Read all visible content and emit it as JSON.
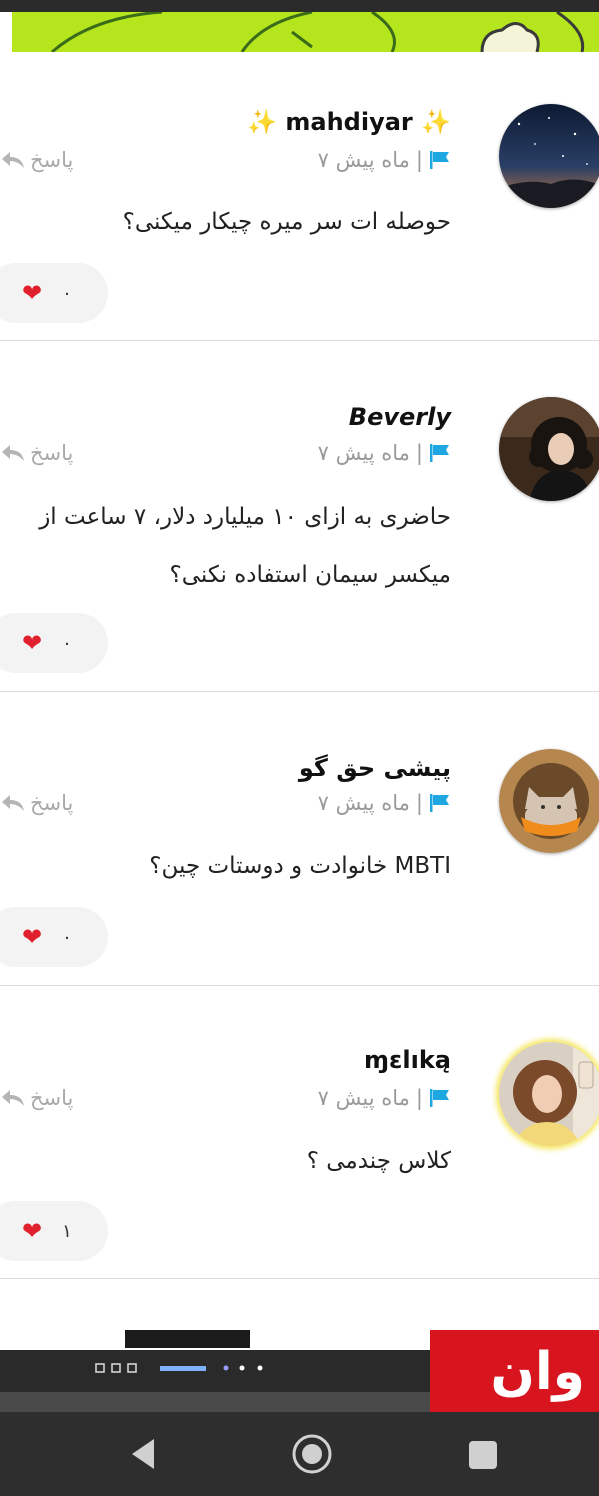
{
  "comments": [
    {
      "username": "✨ mahdiyar ✨",
      "time": "۷ ماه پیش",
      "reply_label": "پاسخ",
      "text": "حوصله ات سر میره چیکار میکنی؟",
      "likes": "۰",
      "avatar": "night-sky-avatar"
    },
    {
      "username": "Beverly",
      "time": "۷ ماه پیش",
      "reply_label": "پاسخ",
      "text": "حاضری به ازای ۱۰ میلیارد دلار، ۷ ساعت از میکسر سیمان استفاده نکنی؟",
      "likes": "۰",
      "avatar": "girl-curly-hair-avatar"
    },
    {
      "username": "پیشی حق گو",
      "time": "۷ ماه پیش",
      "reply_label": "پاسخ",
      "text": "MBTI خانوادت و دوستات چین؟",
      "likes": "۰",
      "avatar": "cat-avatar"
    },
    {
      "username": "ɱɛlıką",
      "time": "۷ ماه پیش",
      "reply_label": "پاسخ",
      "text": "کلاس چندمی ؟",
      "likes": "۱",
      "avatar": "girl-selfie-avatar"
    }
  ],
  "ad": {
    "text": "وان"
  },
  "colors": {
    "flag": "#1ea7e1",
    "heart": "#e0202c",
    "ad_red": "#d8141f",
    "banner": "#b5e61d"
  },
  "icons": {
    "flag": "flag-icon",
    "reply": "reply-arrow-icon",
    "heart": "heart-icon",
    "nav_back": "back-triangle-icon",
    "nav_home": "home-circle-icon",
    "nav_recents": "recents-square-icon"
  }
}
